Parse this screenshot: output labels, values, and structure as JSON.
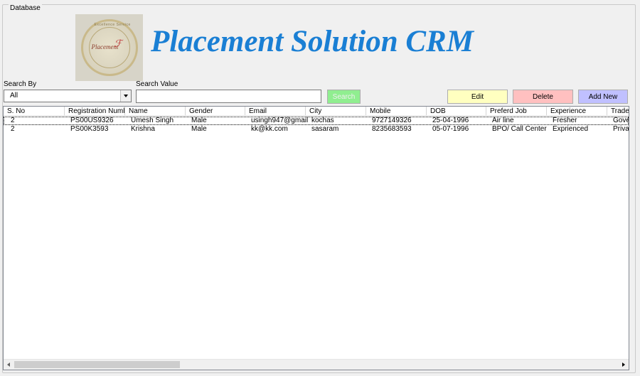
{
  "groupbox": {
    "title": "Database"
  },
  "logo": {
    "brand_text": "Placement",
    "arc_text": "Excellence Service"
  },
  "app_title": "Placement Solution CRM",
  "search_by": {
    "label": "Search By",
    "value": "All"
  },
  "search_value": {
    "label": "Search Value",
    "value": ""
  },
  "buttons": {
    "search": "Search",
    "edit": "Edit",
    "delete": "Delete",
    "add_new": "Add New"
  },
  "colors": {
    "title": "#1a7fd4",
    "search_bg": "#90ee90",
    "edit_bg": "#ffffc0",
    "delete_bg": "#ffc0c0",
    "add_bg": "#c0c0ff"
  },
  "table": {
    "columns": [
      "S. No",
      "Registration Numb",
      "Name",
      "Gender",
      "Email",
      "City",
      "Mobile",
      "DOB",
      "Preferd Job",
      "Experience",
      "Trade"
    ],
    "rows": [
      [
        "2",
        "PS00US9326",
        "Umesh Singh",
        "Male",
        "usingh947@gmail.",
        "kochas",
        "9727149326",
        "25-04-1996",
        "Air line",
        "Fresher",
        "Gove"
      ],
      [
        "2",
        "PS00K3593",
        "Krishna",
        "Male",
        "kk@kk.com",
        "sasaram",
        "8235683593",
        "05-07-1996",
        "BPO/ Call Center",
        "Exprienced",
        "Privat"
      ]
    ]
  }
}
